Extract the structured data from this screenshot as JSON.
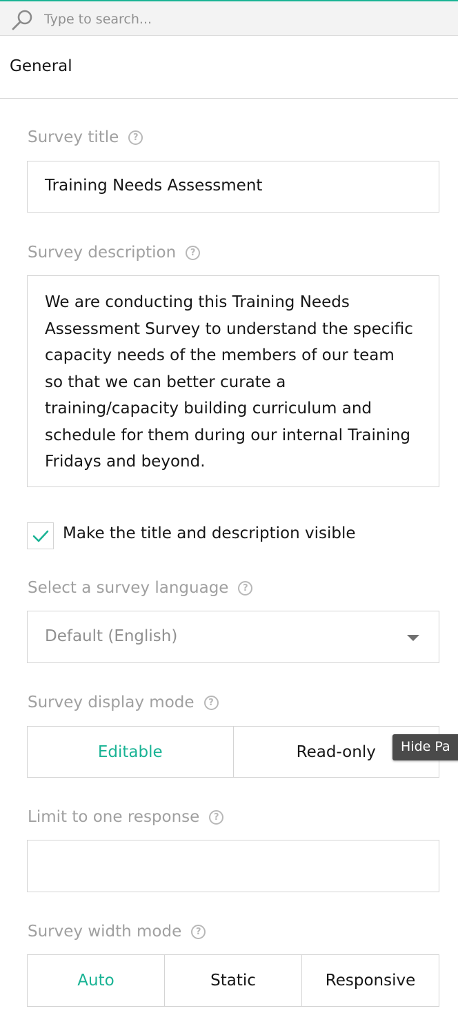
{
  "search": {
    "placeholder": "Type to search..."
  },
  "section": {
    "title": "General"
  },
  "survey_title": {
    "label": "Survey title",
    "value": "Training Needs Assessment"
  },
  "survey_description": {
    "label": "Survey description",
    "value": "We are conducting this Training Needs Assessment Survey to understand the specific capacity needs of the members of our team so that we can better curate a training/capacity building curriculum and schedule for them during our internal Training Fridays and beyond."
  },
  "visibility": {
    "label": "Make the title and description visible",
    "checked": true
  },
  "language": {
    "label": "Select a survey language",
    "value": "Default (English)"
  },
  "display_mode": {
    "label": "Survey display mode",
    "options": [
      "Editable",
      "Read-only"
    ],
    "selected": "Editable"
  },
  "tooltip": {
    "text": "Hide Pa"
  },
  "limit_response": {
    "label": "Limit to one response",
    "value": ""
  },
  "width_mode": {
    "label": "Survey width mode",
    "options": [
      "Auto",
      "Static",
      "Responsive"
    ],
    "selected": "Auto"
  },
  "help_glyph": "?",
  "colors": {
    "accent": "#19b394",
    "label": "#a0a0a0",
    "border": "#d4d4d4",
    "tooltip_bg": "#4a4a4a"
  }
}
